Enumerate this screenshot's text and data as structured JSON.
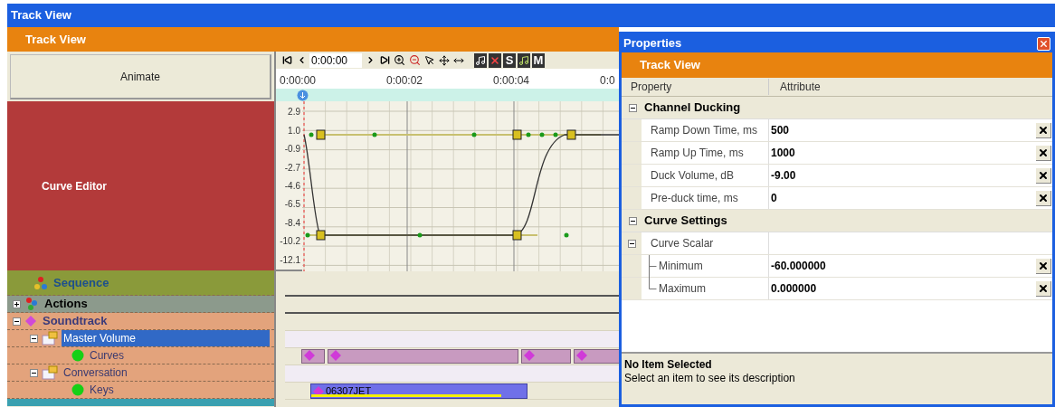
{
  "window": {
    "title": "Track View"
  },
  "header": {
    "title": "Track View"
  },
  "animate_button": "Animate",
  "curve_editor": {
    "label": "Curve Editor"
  },
  "tracks": [
    {
      "label": "Sequence",
      "kind": "sequence",
      "selected": false
    },
    {
      "label": "Actions",
      "kind": "group",
      "expanded": false,
      "selected": false
    },
    {
      "label": "Soundtrack",
      "kind": "track",
      "expanded": true,
      "selected": false,
      "children": [
        {
          "label": "Master Volume",
          "kind": "folder",
          "expanded": true,
          "selected": true,
          "children": [
            {
              "label": "Curves",
              "kind": "curves",
              "selected": false
            }
          ]
        },
        {
          "label": "Conversation",
          "kind": "folder",
          "expanded": true,
          "selected": false,
          "children": [
            {
              "label": "Keys",
              "kind": "keys",
              "selected": false,
              "clip": "06307JET"
            }
          ]
        }
      ]
    }
  ],
  "timeline": {
    "time": "0:00:00",
    "toggles": [
      "S",
      "M"
    ],
    "ruler": [
      "0:00:00",
      "0:00:02",
      "0:00:04",
      "0:0"
    ],
    "y_labels": [
      "2.9",
      "1.0",
      "-0.9",
      "-2.7",
      "-4.6",
      "-6.5",
      "-8.4",
      "-10.2",
      "-12.1"
    ]
  },
  "properties": {
    "title": "Properties",
    "header": "Track View",
    "columns": [
      "Property",
      "Attribute"
    ],
    "sections": [
      {
        "name": "Channel Ducking",
        "expanded": true,
        "rows": [
          {
            "name": "Ramp Down Time, ms",
            "value": "500"
          },
          {
            "name": "Ramp Up Time, ms",
            "value": "1000"
          },
          {
            "name": "Duck Volume, dB",
            "value": "-9.00"
          },
          {
            "name": "Pre-duck time, ms",
            "value": "0"
          }
        ]
      },
      {
        "name": "Curve Settings",
        "expanded": true,
        "rows": [
          {
            "name": "Curve Scalar",
            "expanded": true,
            "children": [
              {
                "name": "Minimum",
                "value": "-60.000000"
              },
              {
                "name": "Maximum",
                "value": "0.000000"
              }
            ]
          }
        ]
      }
    ],
    "description": {
      "title": "No Item Selected",
      "text": "Select an item to see its description"
    }
  }
}
